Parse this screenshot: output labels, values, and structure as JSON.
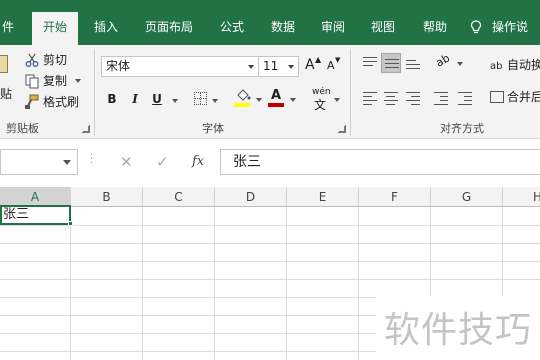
{
  "tabs": [
    {
      "label": "件",
      "active": false
    },
    {
      "label": "开始",
      "active": true
    },
    {
      "label": "插入",
      "active": false
    },
    {
      "label": "页面布局",
      "active": false
    },
    {
      "label": "公式",
      "active": false
    },
    {
      "label": "数据",
      "active": false
    },
    {
      "label": "审阅",
      "active": false
    },
    {
      "label": "视图",
      "active": false
    },
    {
      "label": "帮助",
      "active": false
    }
  ],
  "tell_me": "操作说",
  "clipboard": {
    "paste_label": "贴",
    "cut_label": "剪切",
    "copy_label": "复制",
    "format_painter_label": "格式刷",
    "group_label": "剪贴板"
  },
  "font": {
    "font_name": "宋体",
    "font_size": "11",
    "grow_label": "A",
    "shrink_label": "A",
    "bold_label": "B",
    "italic_label": "I",
    "underline_label": "U",
    "phonetic_label": "wén",
    "group_label": "字体"
  },
  "alignment": {
    "wrap_text_label": "自动换",
    "merge_label": "合并后",
    "group_label": "对齐方式"
  },
  "formula_bar": {
    "cancel_symbol": "✕",
    "enter_symbol": "✓",
    "fx_label": "fx",
    "content": "张三"
  },
  "columns": [
    "A",
    "B",
    "C",
    "D",
    "E",
    "F",
    "G",
    "H"
  ],
  "selected_column": "A",
  "cells": {
    "A1": "张三"
  },
  "watermark": "软件技巧",
  "colors": {
    "accent": "#217346",
    "ribbon_bg": "#f3f3f3",
    "highlight_yellow": "#ffff00",
    "font_red": "#c00000"
  },
  "icons": {
    "cut": "scissors-icon",
    "copy": "copy-icon",
    "format_painter": "paintbrush-icon",
    "tell_me": "lightbulb-icon"
  }
}
